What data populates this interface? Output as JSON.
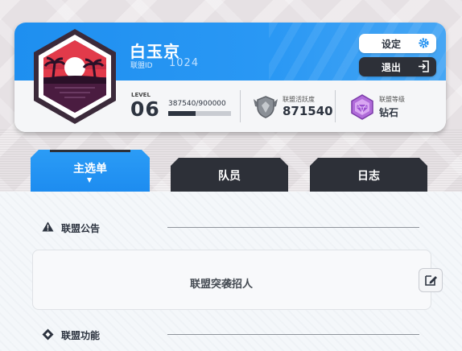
{
  "header": {
    "guild_name": "白玉京",
    "id_label": "联盟ID",
    "id_value": "1024",
    "settings_label": "设定",
    "exit_label": "退出",
    "level_label": "LEVEL",
    "level_value": "06",
    "exp_text": "387540/900000",
    "exp_progress": 0.4306,
    "activity_label": "联盟活跃度",
    "activity_value": "871540",
    "rank_label": "联盟等级",
    "rank_value": "钻石"
  },
  "tabs": [
    {
      "label": "主选单",
      "active": true
    },
    {
      "label": "队员",
      "active": false
    },
    {
      "label": "日志",
      "active": false
    }
  ],
  "sections": {
    "notice_title": "联盟公告",
    "notice_text": "联盟突袭招人",
    "function_title": "联盟功能"
  },
  "colors": {
    "accent_blue": "#1e8ff0",
    "dark": "#2d3038",
    "emblem_red": "#e23a4a",
    "emblem_purple": "#6a2a5a"
  },
  "icons": {
    "settings": "gear-icon",
    "exit": "exit-icon",
    "activity": "shield-wings-icon",
    "rank": "diamond-badge-icon",
    "notice": "warning-icon",
    "function": "diamond-icon",
    "edit": "edit-icon"
  }
}
